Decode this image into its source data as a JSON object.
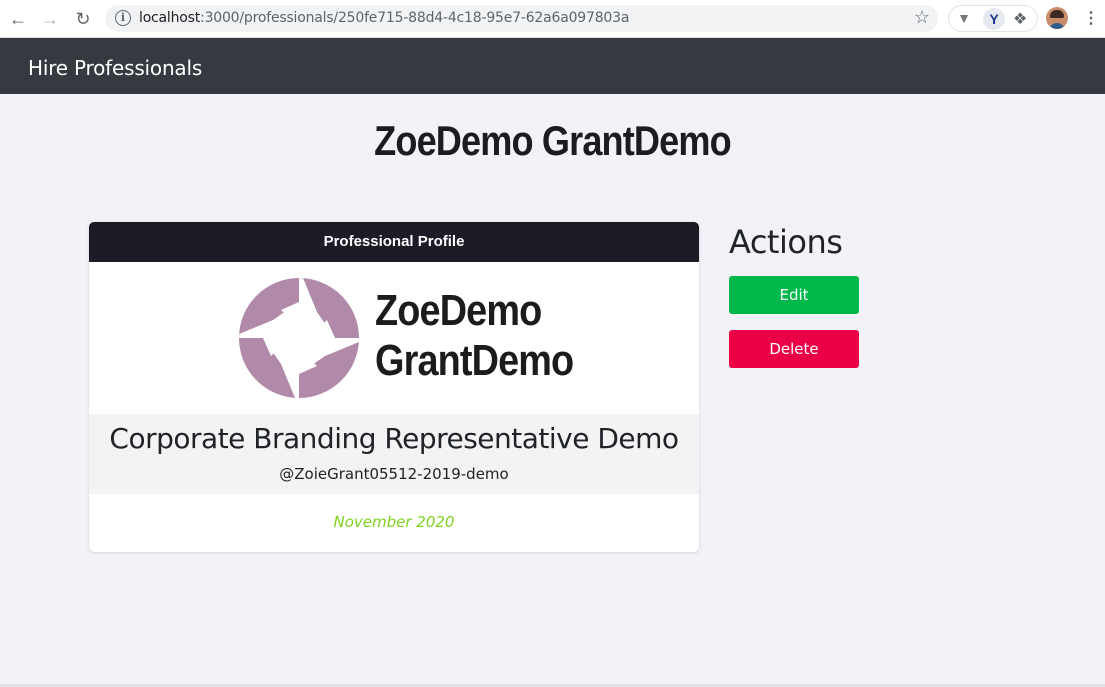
{
  "browser": {
    "url_host": "localhost",
    "url_path": ":3000/professionals/250fe715-88d4-4c18-95e7-62a6a097803a"
  },
  "navbar": {
    "brand": "Hire Professionals"
  },
  "page": {
    "title": "ZoeDemo GrantDemo"
  },
  "card": {
    "header": "Professional Profile",
    "logo_first": "ZoeDemo",
    "logo_last": "GrantDemo",
    "job_title": "Corporate Branding Representative Demo",
    "handle": "@ZoieGrant05512-2019-demo",
    "date": "November 2020",
    "logo_color": "#b08aa8"
  },
  "actions": {
    "title": "Actions",
    "edit_label": "Edit",
    "delete_label": "Delete"
  },
  "colors": {
    "navbar_bg": "#343a40",
    "edit": "#00b94a",
    "delete": "#eb0046",
    "date": "#7ed321"
  }
}
